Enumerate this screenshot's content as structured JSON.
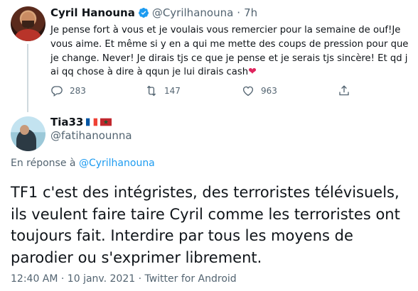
{
  "tweet1": {
    "author_name": "Cyril Hanouna",
    "handle": "@Cyrilhanouna",
    "separator": "·",
    "time": "7h",
    "text": "Je pense fort à vous et je voulais vous remercier pour la semaine de ouf!Je vous aime. Et même si y en a qui me mette des coups de pression pour que je change. Never! Je dirais tjs ce que je pense et je serais tjs sincère! Et qd j ai qq chose à dire à qqun je lui dirais cash",
    "heart_emoji": "❤",
    "replies": "283",
    "retweets": "147",
    "likes": "963",
    "icons": [
      "verified-badge-icon",
      "reply-icon",
      "retweet-icon",
      "like-icon",
      "share-icon"
    ]
  },
  "tweet2": {
    "author_name": "Tia33",
    "handle": "@fatihanounna",
    "flags": [
      "france-flag-icon",
      "morocco-flag-icon"
    ],
    "reply_prefix": "En réponse à",
    "reply_to": "@Cyrilhanouna",
    "text": "TF1 c'est des intégristes, des terroristes télévisuels, ils veulent faire taire Cyril comme les terroristes ont toujours fait. Interdire par tous les moyens de parodier ou s'exprimer librement.",
    "timestamp": "12:40 AM · 10 janv. 2021 · Twitter for Android"
  },
  "colors": {
    "text": "#0f1419",
    "secondary": "#536471",
    "link": "#1d9bf0",
    "heart": "#e0245e"
  }
}
